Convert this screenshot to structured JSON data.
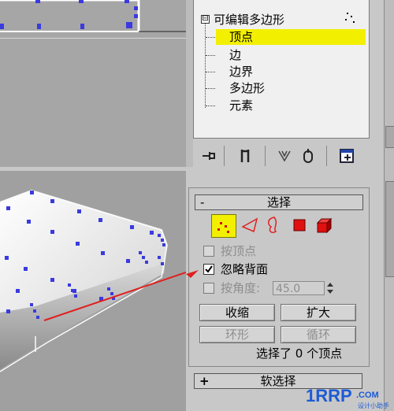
{
  "modifier_stack": {
    "root_label": "可编辑多边形",
    "items": [
      {
        "label": "顶点",
        "selected": true
      },
      {
        "label": "边",
        "selected": false
      },
      {
        "label": "边界",
        "selected": false
      },
      {
        "label": "多边形",
        "selected": false
      },
      {
        "label": "元素",
        "selected": false
      }
    ],
    "collapse_glyph": "⊟"
  },
  "stack_toolbar": {
    "icons": [
      "pin-stack-icon",
      "show-end-result-icon",
      "make-unique-icon",
      "remove-modifier-icon",
      "configure-modifier-sets-icon"
    ]
  },
  "selection_rollout": {
    "collapse_glyph": "-",
    "title": "选择",
    "subobject_icons": [
      "vertex-icon",
      "edge-icon",
      "border-icon",
      "polygon-icon",
      "element-icon"
    ],
    "by_vertex": {
      "label": "按顶点",
      "checked": false,
      "enabled": false
    },
    "ignore_backfacing": {
      "label": "忽略背面",
      "checked": true,
      "enabled": true
    },
    "by_angle": {
      "label": "按角度:",
      "checked": false,
      "enabled": false,
      "value": "45.0"
    },
    "shrink_label": "收缩",
    "grow_label": "扩大",
    "ring_label": "环形",
    "loop_label": "循环",
    "status": "选择了 0 个顶点"
  },
  "soft_selection_rollout": {
    "collapse_glyph": "+",
    "title": "软选择"
  },
  "watermark": {
    "brand": "1RRP",
    "domain": ".COM",
    "subtitle": "设计小助手"
  },
  "colors": {
    "selection_yellow": "#f2f000",
    "vertex_blue": "#3a3ae0",
    "annotation_red": "#e02020"
  }
}
